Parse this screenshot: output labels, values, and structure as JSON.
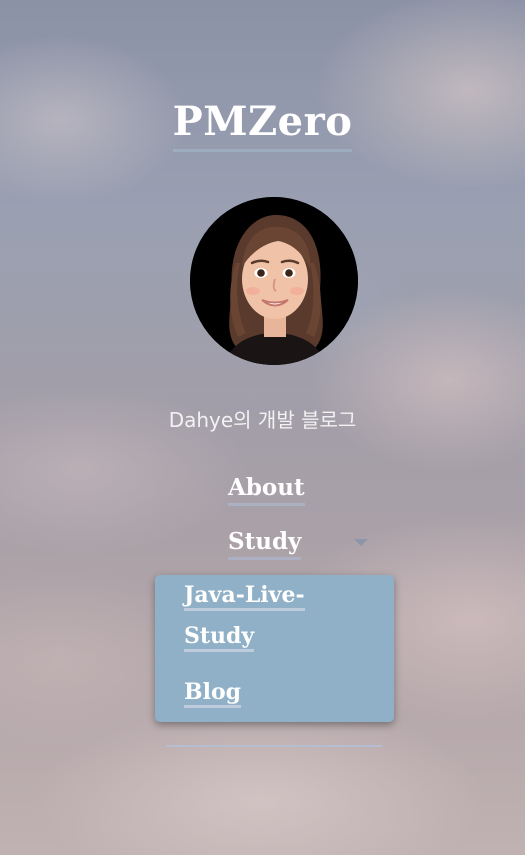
{
  "site": {
    "title": "PMZero",
    "tagline": "Dahye의 개발 블로그"
  },
  "avatar": {
    "icon": "memoji-avatar"
  },
  "nav": {
    "items": [
      {
        "label": "About"
      },
      {
        "label": "Study",
        "expanded": true
      }
    ],
    "dropdown": [
      {
        "label": "Java-Live-Study"
      },
      {
        "label": "Blog"
      }
    ]
  },
  "colors": {
    "dropdown_bg": "#8fb0c6",
    "text": "#ffffff",
    "underline": "#aab4c8"
  }
}
